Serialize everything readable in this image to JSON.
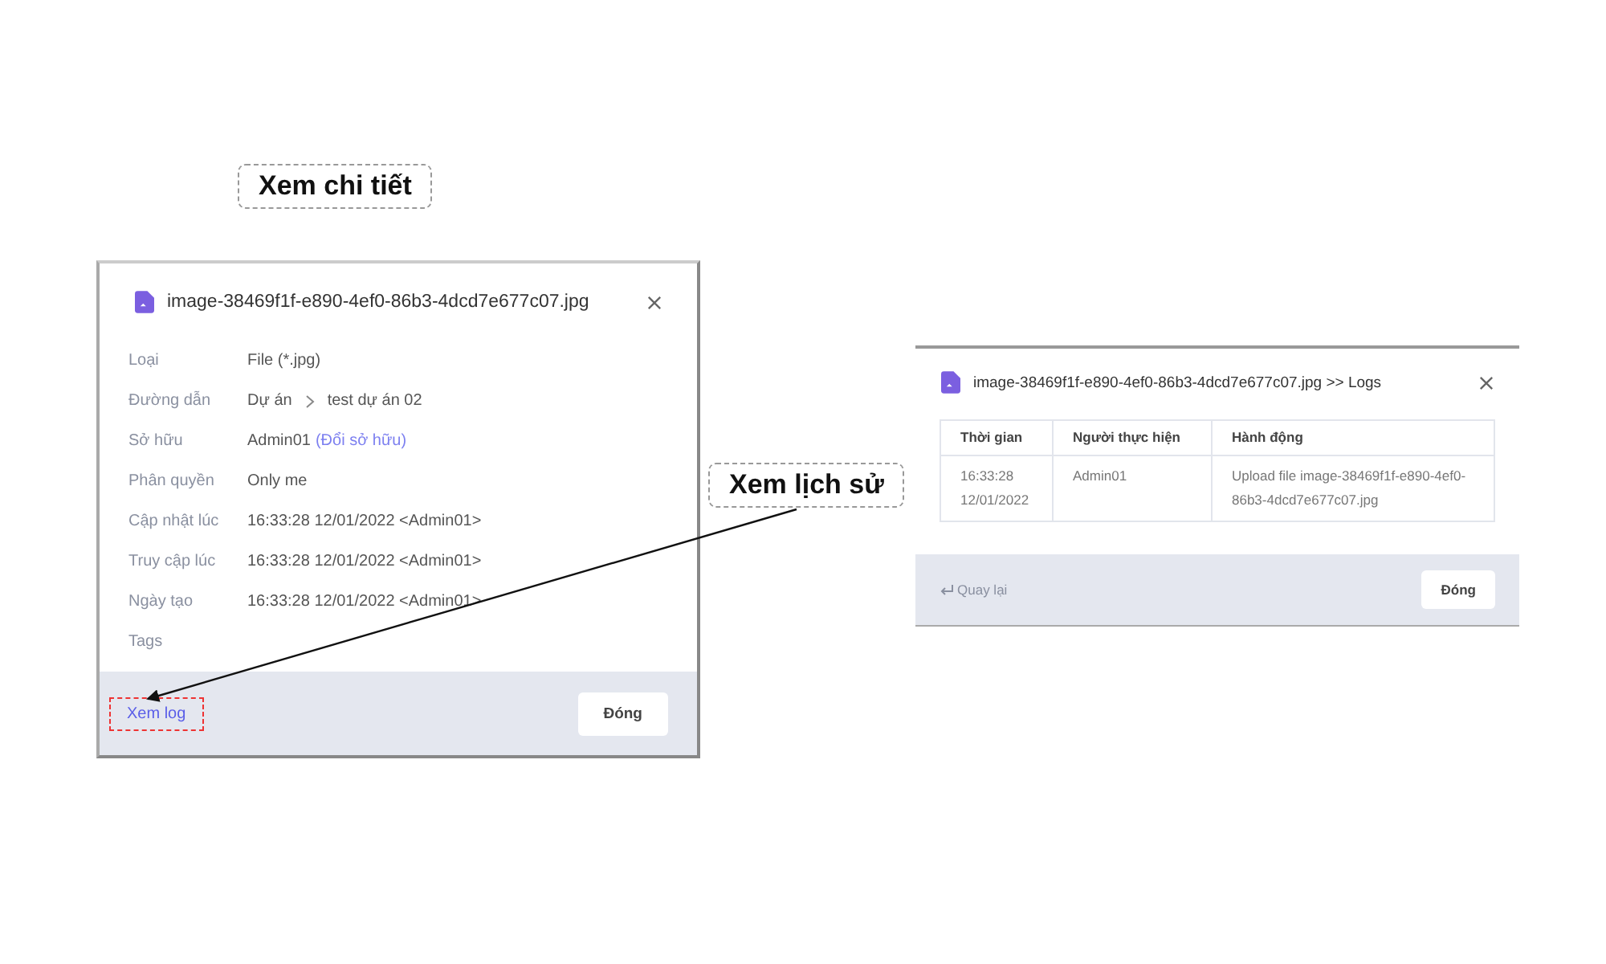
{
  "callouts": [
    {
      "text": "Xem chi tiết"
    },
    {
      "text": "Xem lịch sử"
    }
  ],
  "detail_dialog": {
    "title": "image-38469f1f-e890-4ef0-86b3-4dcd7e677c07.jpg",
    "fields": [
      {
        "kind": "text",
        "label": "Loại",
        "value": "File (*.jpg)"
      },
      {
        "kind": "path",
        "label": "Đường dẫn",
        "segments": [
          "Dự án",
          "test dự án 02"
        ]
      },
      {
        "kind": "owner",
        "label": "Sở hữu",
        "value": "Admin01",
        "link": "(Đổi sở hữu)"
      },
      {
        "kind": "text",
        "label": "Phân quyền",
        "value": "Only me"
      },
      {
        "kind": "text",
        "label": "Cập nhật lúc",
        "value": "16:33:28 12/01/2022 <Admin01>"
      },
      {
        "kind": "text",
        "label": "Truy cập lúc",
        "value": "16:33:28 12/01/2022 <Admin01>"
      },
      {
        "kind": "text",
        "label": "Ngày tạo",
        "value": "16:33:28 12/01/2022 <Admin01>"
      },
      {
        "kind": "empty",
        "label": "Tags"
      }
    ],
    "log_link": {
      "text": "Xem log",
      "highlighted": true
    },
    "close_button": "Đóng"
  },
  "log_dialog": {
    "title": "image-38469f1f-e890-4ef0-86b3-4dcd7e677c07.jpg >> Logs",
    "columns": [
      "Thời gian",
      "Người thực hiện",
      "Hành động"
    ],
    "rows": [
      {
        "cells": [
          "16:33:28 12/01/2022",
          "Admin01",
          "Upload file image-38469f1f-e890-4ef0-86b3-4dcd7e677c07.jpg"
        ]
      }
    ],
    "back_link": "Quay lại",
    "close_button": "Đóng"
  }
}
